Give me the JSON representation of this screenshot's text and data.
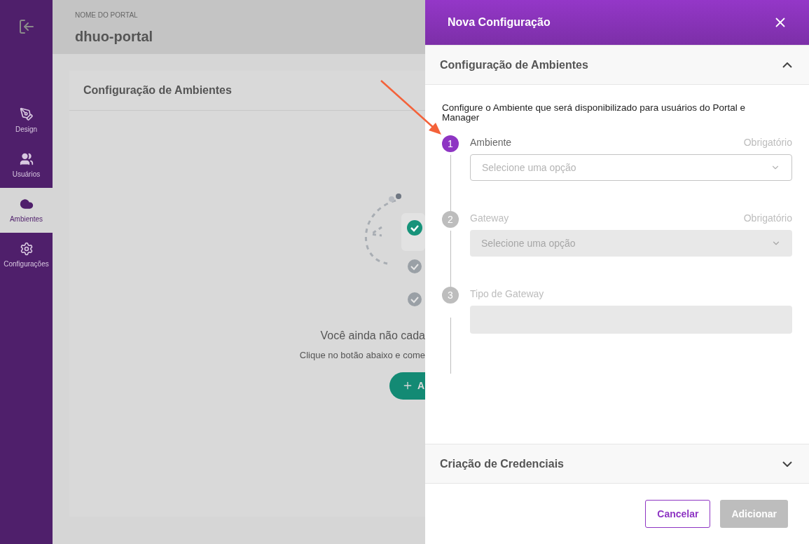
{
  "sidebar": {
    "items": [
      {
        "label": "Design",
        "selected": false
      },
      {
        "label": "Usuários",
        "selected": false
      },
      {
        "label": "Ambientes",
        "selected": true
      },
      {
        "label": "Configurações",
        "selected": false
      }
    ]
  },
  "header": {
    "caption": "NOME DO PORTAL",
    "title": "dhuo-portal"
  },
  "card": {
    "title": "Configuração de Ambientes",
    "empty_title": "Você ainda não cada",
    "empty_text": "Clique no botão abaixo e come",
    "button": "A"
  },
  "drawer": {
    "title": "Nova Configuração",
    "sections": [
      {
        "title": "Configuração de Ambientes",
        "expanded": true,
        "intro": "Configure o Ambiente que será disponibilizado para usuários do Portal e Manager",
        "steps": [
          {
            "number": "1",
            "label": "Ambiente",
            "required": "Obrigatório",
            "kind": "select",
            "placeholder": "Selecione uma opção",
            "disabled": false
          },
          {
            "number": "2",
            "label": "Gateway",
            "required": "Obrigatório",
            "kind": "select",
            "placeholder": "Selecione uma opção",
            "disabled": true
          },
          {
            "number": "3",
            "label": "Tipo de Gateway",
            "kind": "text",
            "disabled": true
          }
        ]
      },
      {
        "title": "Criação de Credenciais",
        "expanded": false
      }
    ],
    "buttons": [
      {
        "label": "Cancelar",
        "kind": "outline",
        "disabled": false
      },
      {
        "label": "Adicionar",
        "kind": "primary",
        "disabled": true
      }
    ]
  }
}
